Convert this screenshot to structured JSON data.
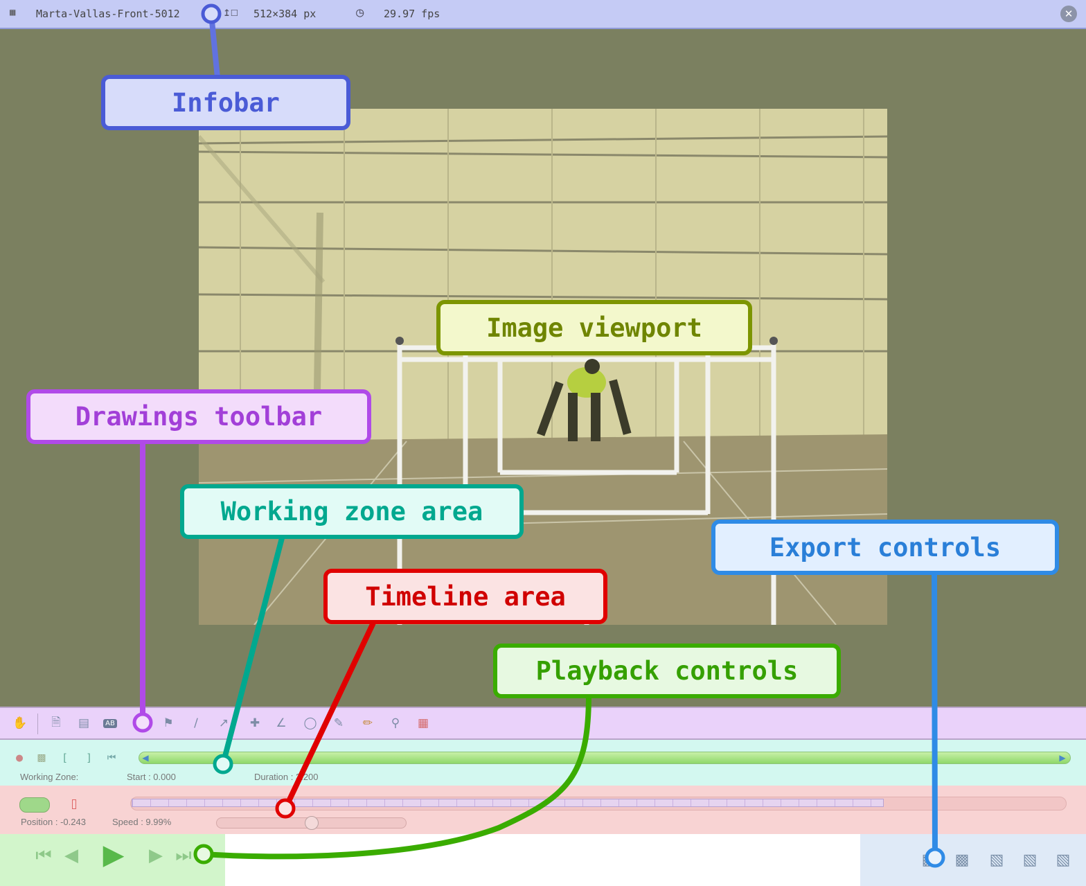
{
  "infobar": {
    "filename": "Marta-Vallas-Front-5012",
    "resolution": "512×384 px",
    "framerate": "29.97 fps",
    "icons": [
      "film-strip-icon",
      "resize-icon",
      "clock-icon",
      "close-icon"
    ],
    "color": "#c5cbf5"
  },
  "callouts": {
    "infobar": "Infobar",
    "image_viewport": "Image viewport",
    "drawings_toolbar": "Drawings toolbar",
    "working_zone": "Working zone area",
    "timeline": "Timeline area",
    "export": "Export controls",
    "playback": "Playback controls"
  },
  "drawings_toolbar": {
    "tools": [
      "hand-tool-icon",
      "add-keyframe-icon",
      "comments-icon",
      "label-icon",
      "human-model-icon",
      "line-icon",
      "arrow-icon",
      "cross-icon",
      "angle-icon",
      "circle-icon",
      "pencil-icon",
      "brush-icon",
      "magnifier-icon",
      "color-grid-icon"
    ],
    "label_text": "AB"
  },
  "working_zone": {
    "label": "Working Zone:",
    "start": "Start : 0.000",
    "duration": "Duration : 3.200"
  },
  "timeline": {
    "position": "Position : -0.243",
    "speed": "Speed : 9.99%",
    "speed_level": 0.5
  },
  "playback": {
    "buttons": [
      "first-frame-icon",
      "previous-frame-icon",
      "play-icon",
      "next-frame-icon",
      "last-frame-icon"
    ]
  },
  "export": {
    "buttons": [
      "snapshot-icon",
      "multi-snapshot-icon",
      "save-video-icon",
      "edit-video-icon",
      "export-video-icon"
    ]
  },
  "colors": {
    "infobar": "#4a5bd6",
    "viewport": "#7c9500",
    "drawings": "#b04ae8",
    "working_zone": "#00a88f",
    "timeline": "#e00000",
    "playback": "#3aac00",
    "export": "#2f8be6"
  }
}
